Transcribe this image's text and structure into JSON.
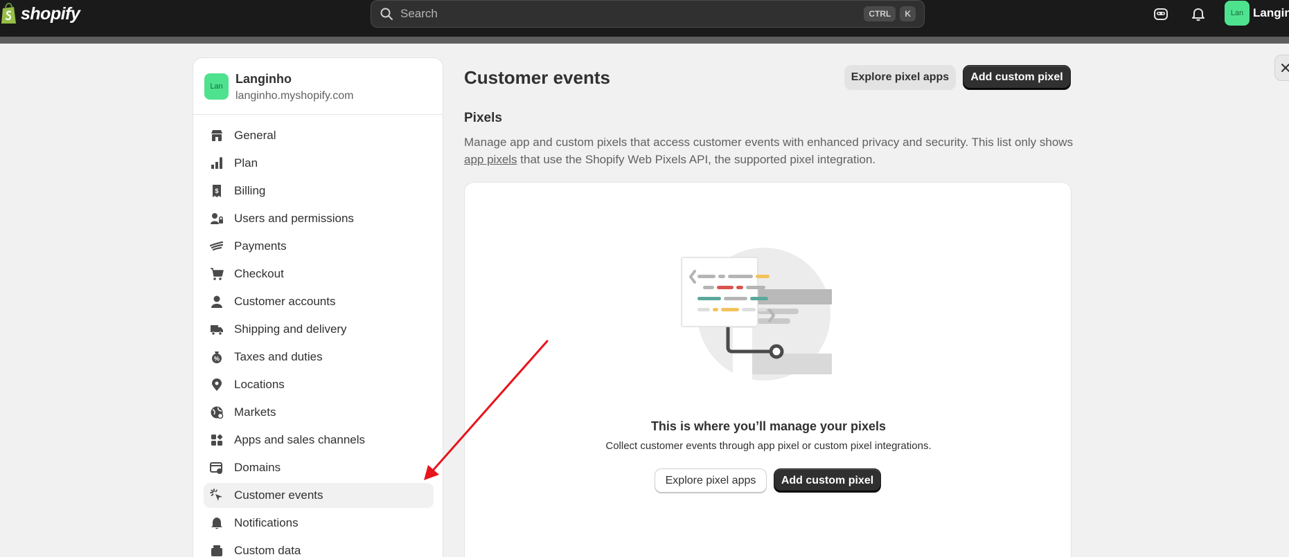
{
  "topbar": {
    "logo_text": "shopify",
    "search_placeholder": "Search",
    "shortcut_key1": "CTRL",
    "shortcut_key2": "K",
    "avatar_initials": "Lan",
    "store_name": "Langinho",
    "icons": [
      "shopify-bag-icon",
      "search-icon",
      "sidekick-icon",
      "bell-icon"
    ]
  },
  "sidebar": {
    "store": {
      "initials": "Lan",
      "name": "Langinho",
      "url": "langinho.myshopify.com"
    },
    "items": [
      {
        "label": "General",
        "icon": "store-icon"
      },
      {
        "label": "Plan",
        "icon": "plan-icon"
      },
      {
        "label": "Billing",
        "icon": "billing-icon"
      },
      {
        "label": "Users and permissions",
        "icon": "users-icon"
      },
      {
        "label": "Payments",
        "icon": "payments-icon"
      },
      {
        "label": "Checkout",
        "icon": "cart-icon"
      },
      {
        "label": "Customer accounts",
        "icon": "person-icon"
      },
      {
        "label": "Shipping and delivery",
        "icon": "truck-icon"
      },
      {
        "label": "Taxes and duties",
        "icon": "tax-icon"
      },
      {
        "label": "Locations",
        "icon": "location-pin-icon"
      },
      {
        "label": "Markets",
        "icon": "globe-icon"
      },
      {
        "label": "Apps and sales channels",
        "icon": "apps-icon"
      },
      {
        "label": "Domains",
        "icon": "domains-icon"
      },
      {
        "label": "Customer events",
        "icon": "cursor-click-icon",
        "active": true
      },
      {
        "label": "Notifications",
        "icon": "bell-icon"
      },
      {
        "label": "Custom data",
        "icon": "custom-data-icon"
      }
    ]
  },
  "main": {
    "title": "Customer events",
    "explore_button": "Explore pixel apps",
    "add_button": "Add custom pixel",
    "section_title": "Pixels",
    "desc_part1": "Manage app and custom pixels that access customer events with enhanced privacy and security. This list only shows ",
    "desc_link": "app pixels",
    "desc_part2": " that use the Shopify Web Pixels API, the supported pixel integration.",
    "empty_title": "This is where you’ll manage your pixels",
    "empty_desc": "Collect customer events through app pixel or custom pixel integrations.",
    "empty_explore_button": "Explore pixel apps",
    "empty_add_button": "Add custom pixel"
  },
  "colors": {
    "topbar": "#1a1a1a",
    "accent_green": "#4ee28f",
    "primary_button": "#303030",
    "annotation_arrow": "#e8141b"
  }
}
